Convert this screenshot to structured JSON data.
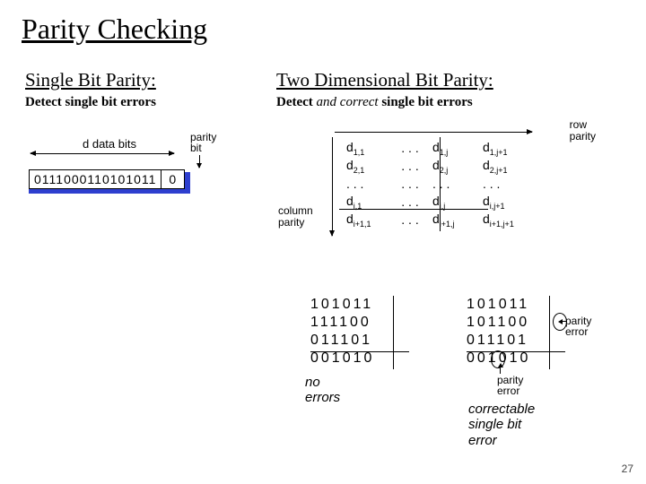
{
  "title": "Parity Checking",
  "left": {
    "heading": "Single Bit Parity:",
    "desc": "Detect single bit errors",
    "d_label": "d data bits",
    "p_label_1": "parity",
    "p_label_2": "bit",
    "data_bits": "0111000110101011",
    "parity_bit": "0"
  },
  "right": {
    "heading": "Two Dimensional Bit Parity:",
    "desc_prefix": "Detect ",
    "desc_em": "and correct",
    "desc_suffix": " single bit errors",
    "row_label_1": "row",
    "row_label_2": "parity",
    "col_label_1": "column",
    "col_label_2": "parity",
    "matrix_rows": [
      [
        "d",
        "1,1",
        ". . .",
        "d",
        "1,j",
        "d",
        "1,j+1"
      ],
      [
        "d",
        "2,1",
        ". . .",
        "d",
        "2,j",
        "d",
        "2,j+1"
      ],
      [
        "",
        "",
        ". . .",
        "",
        ". . .",
        "",
        ". . ."
      ],
      [
        "d",
        "i,1",
        ". . .",
        "d",
        "i,j",
        "d",
        "i,j+1"
      ],
      [
        "d",
        "i+1,1",
        ". . .",
        "d",
        "i+1,j",
        "d",
        "i+1,j+1"
      ]
    ]
  },
  "examples": {
    "block1": [
      "101011",
      "111100",
      "011101",
      "001010"
    ],
    "block2": [
      "101011",
      "101100",
      "011101",
      "001010"
    ],
    "caption1": "no errors",
    "parity_error": "parity",
    "parity_error2": "error",
    "caption2a": "correctable",
    "caption2b": "single bit error"
  },
  "page": "27"
}
